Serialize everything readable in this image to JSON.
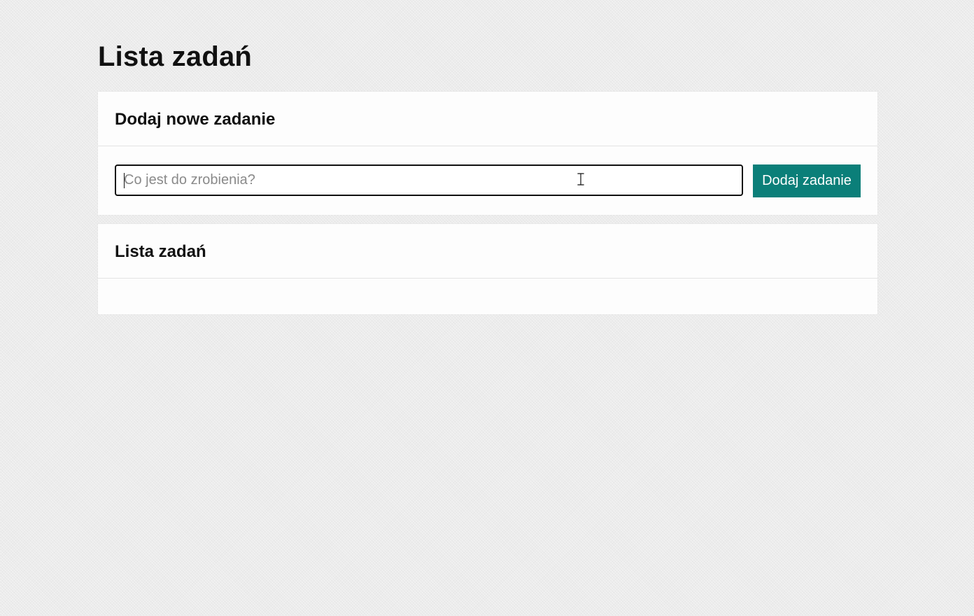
{
  "page": {
    "title": "Lista zadań"
  },
  "add_task": {
    "heading": "Dodaj nowe zadanie",
    "input_placeholder": "Co jest do zrobienia?",
    "input_value": "",
    "button_label": "Dodaj zadanie"
  },
  "task_list": {
    "heading": "Lista zadań",
    "items": []
  },
  "colors": {
    "accent": "#0b7f79",
    "background": "#ececec",
    "card": "#fdfdfd"
  },
  "icons": {
    "mouse_cursor": "text-select-cursor-icon"
  }
}
